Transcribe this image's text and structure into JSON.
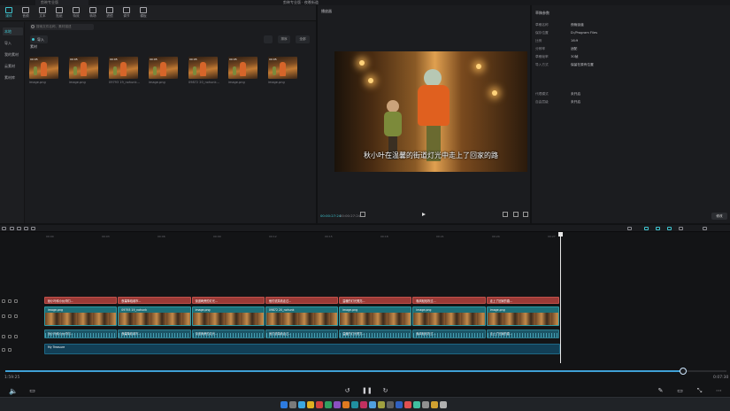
{
  "window": {
    "title": "剪映专业版 · 夜晚街道",
    "tab": "剪映专业版"
  },
  "toolbar": {
    "tools": [
      {
        "label": "媒体",
        "icon": "media-icon",
        "active": true
      },
      {
        "label": "音频",
        "icon": "audio-icon"
      },
      {
        "label": "文本",
        "icon": "text-icon"
      },
      {
        "label": "贴纸",
        "icon": "sticker-icon"
      },
      {
        "label": "特效",
        "icon": "effects-icon"
      },
      {
        "label": "转场",
        "icon": "transition-icon"
      },
      {
        "label": "滤镜",
        "icon": "filter-icon"
      },
      {
        "label": "调节",
        "icon": "adjust-icon"
      },
      {
        "label": "模板",
        "icon": "template-icon"
      }
    ]
  },
  "sidenav": {
    "items": [
      "本地",
      "导入",
      "我的素材",
      "云素材",
      "素材库"
    ]
  },
  "media": {
    "search_placeholder": "搜索文件名称、素材描述",
    "import_label": "导入",
    "view_label": "",
    "sort_label": "排序",
    "filter_label": "全部",
    "section_label": "素材",
    "thumbs": [
      {
        "name": "image.png",
        "duration": "00:05"
      },
      {
        "name": "image.png",
        "duration": "00:05"
      },
      {
        "name": "09793 19_nohunk...",
        "duration": "00:05"
      },
      {
        "name": "image.png",
        "duration": "00:05"
      },
      {
        "name": "09872 20_nohunk...",
        "duration": "00:05"
      },
      {
        "name": "image.png",
        "duration": "00:05"
      },
      {
        "name": "image.png",
        "duration": "00:05"
      }
    ]
  },
  "preview": {
    "title": "播放器",
    "subtitle": "秋小叶在温馨的街道灯光中走上了回家的路",
    "current_time": "00:00:27:24",
    "total_time": "00:00:27:24"
  },
  "properties": {
    "title": "草稿参数",
    "rows": [
      {
        "k": "草稿名称",
        "v": "夜晚街道"
      },
      {
        "k": "保存位置",
        "v": "D:/Program Files"
      },
      {
        "k": "比例",
        "v": "16:9"
      },
      {
        "k": "分辨率",
        "v": "适配"
      },
      {
        "k": "草稿帧率",
        "v": "30帧"
      },
      {
        "k": "导入方式",
        "v": "保留在原有位置"
      }
    ],
    "rows2": [
      {
        "k": "代理模式",
        "v": "未开启"
      },
      {
        "k": "自由层级",
        "v": "未开启"
      }
    ],
    "save_label": "修改"
  },
  "timeline": {
    "ruler": [
      "00:00",
      "00:03",
      "00:06",
      "00:09",
      "00:12",
      "00:15",
      "00:18",
      "00:21",
      "00:24",
      "00:27"
    ],
    "text_clips": [
      "秋小叶和小伙伴们...",
      "夜幕降临城市...",
      "街道两旁的灯光...",
      "他们说笑着走过...",
      "温暖的灯光照亮...",
      "晚风轻轻吹过...",
      "走上了回家的路..."
    ],
    "video_clips": [
      "image.png",
      "09793 19_nohunk",
      "image.png",
      "09872 20_nohunk",
      "image.png",
      "image.png",
      "image.png"
    ],
    "audio_clips": [
      "秋小叶和小伙伴们...",
      "夜幕降临城市...",
      "街道两旁的灯光...",
      "他们说笑着走过...",
      "温暖的灯光照亮...",
      "晚风轻轻吹过...",
      "走上了回家的路..."
    ],
    "music_label": "My Treasure"
  },
  "bottom": {
    "left_time": "1:59:25",
    "right_time": "0:07:30",
    "progress": 0.94
  }
}
